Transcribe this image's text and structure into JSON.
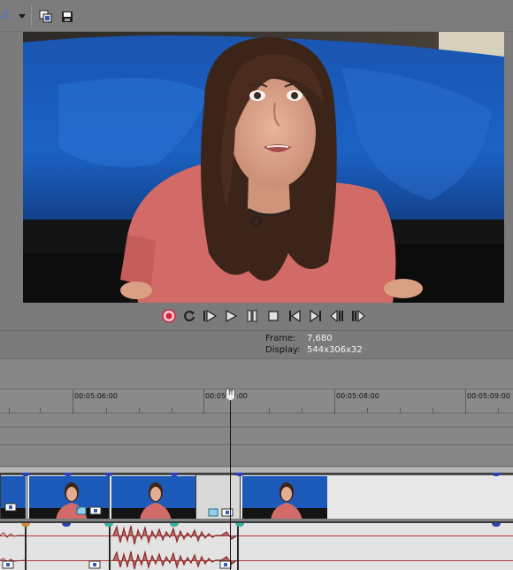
{
  "toolbar": {
    "grid_icon": "grid-icon",
    "buttons": [
      "split-screen-icon",
      "save-icon"
    ]
  },
  "transport": {
    "buttons": [
      "record-icon",
      "loop-icon",
      "play-from-start-icon",
      "play-icon",
      "pause-icon",
      "stop-icon",
      "prev-frame-icon",
      "next-frame-icon",
      "jog-back-icon",
      "jog-forward-icon"
    ]
  },
  "frame_info": {
    "frame_label": "Frame:",
    "frame_value": "7,680",
    "display_label": "Display:",
    "display_value": "544x306x32"
  },
  "ruler": {
    "ticks": [
      {
        "label": "00:05:06:00"
      },
      {
        "label": "00:05:0"
      },
      {
        "label": ":00"
      },
      {
        "label": "00:05:08:00"
      },
      {
        "label": "00:05:09:00"
      }
    ]
  },
  "colors": {
    "accent_blue": "#2e3fb0",
    "audio_wave": "#8b2b2b",
    "record_red": "#d6243c"
  }
}
